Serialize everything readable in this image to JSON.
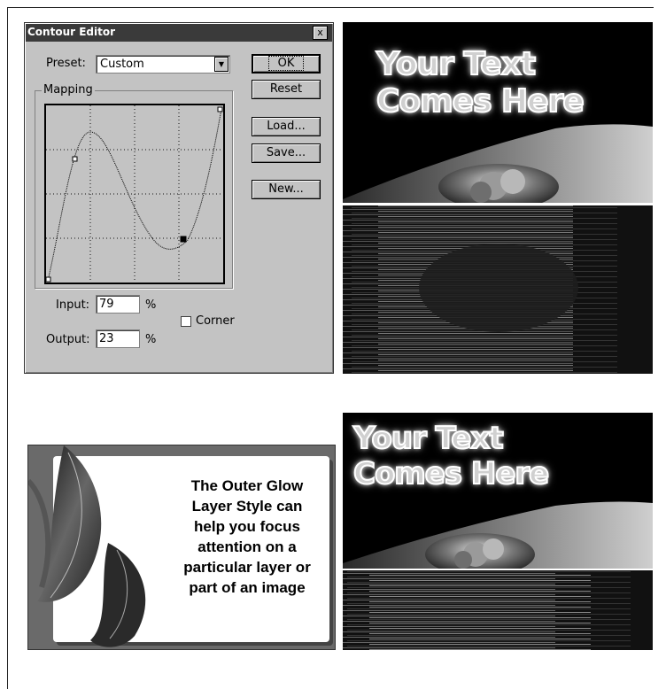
{
  "dialog": {
    "title": "Contour Editor",
    "close_label": "x",
    "preset_label": "Preset:",
    "preset_value": "Custom",
    "buttons": {
      "ok": "OK",
      "reset": "Reset",
      "load": "Load...",
      "save": "Save...",
      "new": "New..."
    },
    "mapping_label": "Mapping",
    "input_label": "Input:",
    "input_value": "79",
    "output_label": "Output:",
    "output_value": "23",
    "percent": "%",
    "corner_label": "Corner",
    "corner_checked": false
  },
  "image_top": {
    "line1": "Your Text",
    "line2": "Comes Here"
  },
  "image_bottom": {
    "line1": "Your Text",
    "line2": "Comes Here"
  },
  "card": {
    "lines": [
      "The Outer Glow",
      "Layer Style can",
      "help you focus",
      "attention on a",
      "particular layer or",
      "part of an image"
    ]
  }
}
